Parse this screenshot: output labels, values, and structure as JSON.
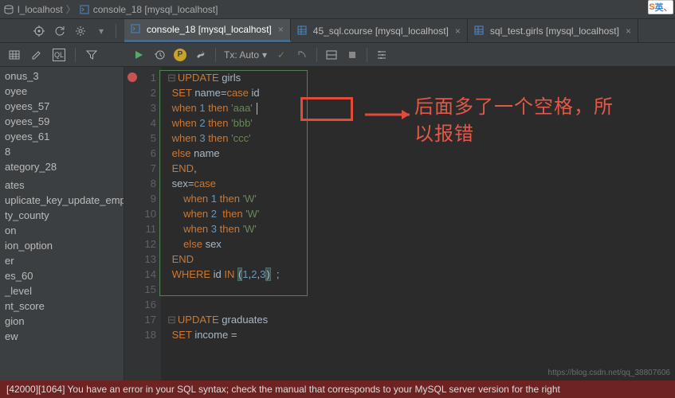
{
  "breadcrumb": {
    "item1": "l_localhost",
    "item2": "console_18 [mysql_localhost]"
  },
  "tabs": [
    {
      "label": "console_18 [mysql_localhost]",
      "active": true
    },
    {
      "label": "45_sql.course [mysql_localhost]",
      "active": false
    },
    {
      "label": "sql_test.girls [mysql_localhost]",
      "active": false
    }
  ],
  "runbar": {
    "tx_label": "Tx: Auto"
  },
  "sidebar": {
    "items": [
      "onus_3",
      "oyee",
      "oyees_57",
      "oyees_59",
      "oyees_61",
      "8",
      "ategory_28",
      "",
      "ates",
      "uplicate_key_update_employ",
      "ty_county",
      "on",
      "ion_option",
      "er",
      "es_60",
      "_level",
      "nt_score",
      "gion",
      "ew"
    ]
  },
  "code": {
    "lines": [
      {
        "n": 1,
        "err": true,
        "html": "<span class='kw'>UPDATE</span> <span class='id'>girls</span>"
      },
      {
        "n": 2,
        "html": "<span class='kw'>SET</span> <span class='id'>name</span>=<span class='kw'>case</span> <span class='id'>id</span>"
      },
      {
        "n": 3,
        "html": "<span class='kw'>when</span> <span class='num'>1</span> <span class='kw'>then</span> <span class='str'>'aaa'</span> <span class='caret'></span>"
      },
      {
        "n": 4,
        "html": "<span class='kw'>when</span> <span class='num'>2</span> <span class='kw'>then</span> <span class='str'>'bbb'</span>"
      },
      {
        "n": 5,
        "html": "<span class='kw'>when</span> <span class='num'>3</span> <span class='kw'>then</span> <span class='str'>'ccc'</span>"
      },
      {
        "n": 6,
        "html": "<span class='kw'>else</span> <span class='id'>name</span>"
      },
      {
        "n": 7,
        "html": "<span class='kw'>END</span><span class='punct'>,</span>"
      },
      {
        "n": 8,
        "html": "<span class='id'>sex</span>=<span class='kw'>case</span>"
      },
      {
        "n": 9,
        "html": "    <span class='kw'>when</span> <span class='num'>1</span> <span class='kw'>then</span> <span class='str'>'W'</span>"
      },
      {
        "n": 10,
        "html": "    <span class='kw'>when</span> <span class='num'>2</span>  <span class='kw'>then</span> <span class='str'>'W'</span>"
      },
      {
        "n": 11,
        "html": "    <span class='kw'>when</span> <span class='num'>3</span> <span class='kw'>then</span> <span class='str'>'W'</span>"
      },
      {
        "n": 12,
        "html": "    <span class='kw'>else</span> <span class='id'>sex</span>"
      },
      {
        "n": 13,
        "html": "<span class='kw'>END</span>"
      },
      {
        "n": 14,
        "html": "<span class='kw'>WHERE</span> <span class='id'>id</span> <span class='kw'>IN</span> <span class='paren-hl'>(</span><span class='num'>1</span>,<span class='num'>2</span>,<span class='num'>3</span><span class='paren-hl'>)</span>  <span class='punct'>;</span>"
      },
      {
        "n": 15,
        "html": ""
      },
      {
        "n": 16,
        "html": ""
      },
      {
        "n": 17,
        "html": "<span class='kw'>UPDATE</span> <span class='id'>graduates</span>"
      },
      {
        "n": 18,
        "html": "<span class='kw'>SET</span> <span class='id'>income</span> <span class='punct'>=</span>"
      }
    ]
  },
  "annotation": {
    "line1": "后面多了一个空格，所",
    "line2": "以报错"
  },
  "status": {
    "text": "[42000][1064] You have an error in your SQL syntax; check the manual that corresponds to your MySQL server version for the right"
  },
  "watermark": "https://blog.csdn.net/qq_38807606",
  "ime": {
    "s": "S",
    "y": "英"
  }
}
